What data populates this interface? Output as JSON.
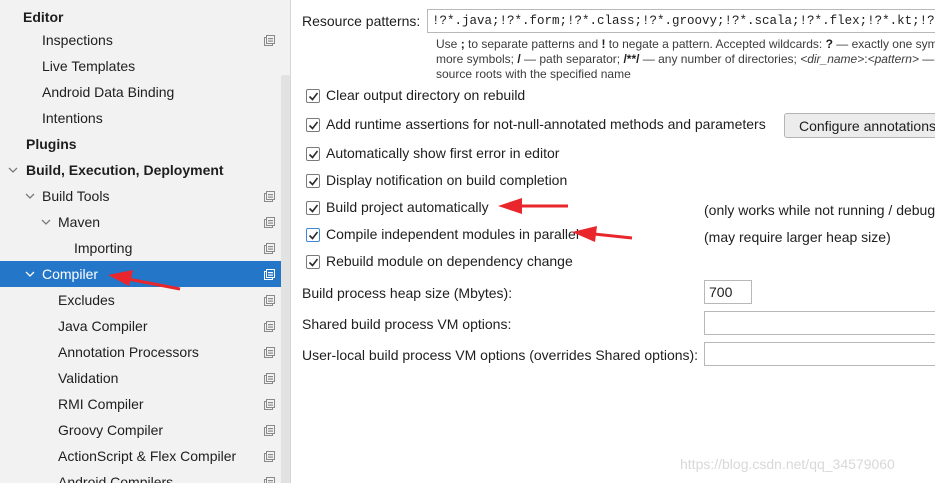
{
  "sidebar": {
    "items": [
      {
        "label": "Editor",
        "bold": true,
        "has_config_icon": false
      },
      {
        "label": "Inspections",
        "bold": false,
        "has_config_icon": true
      },
      {
        "label": "Live Templates",
        "bold": false,
        "has_config_icon": false
      },
      {
        "label": "Android Data Binding",
        "bold": false,
        "has_config_icon": false
      },
      {
        "label": "Intentions",
        "bold": false,
        "has_config_icon": false
      },
      {
        "label": "Plugins",
        "bold": true,
        "has_config_icon": false
      },
      {
        "label": "Build, Execution, Deployment",
        "bold": true,
        "expanded": true,
        "has_config_icon": false
      },
      {
        "label": "Build Tools",
        "bold": false,
        "expanded": true,
        "has_config_icon": true
      },
      {
        "label": "Maven",
        "bold": false,
        "expanded": true,
        "has_config_icon": true
      },
      {
        "label": "Importing",
        "bold": false,
        "has_config_icon": true
      },
      {
        "label": "Compiler",
        "bold": false,
        "expanded": true,
        "selected": true,
        "has_config_icon": true
      },
      {
        "label": "Excludes",
        "bold": false,
        "has_config_icon": true
      },
      {
        "label": "Java Compiler",
        "bold": false,
        "has_config_icon": true
      },
      {
        "label": "Annotation Processors",
        "bold": false,
        "has_config_icon": true
      },
      {
        "label": "Validation",
        "bold": false,
        "has_config_icon": true
      },
      {
        "label": "RMI Compiler",
        "bold": false,
        "has_config_icon": true
      },
      {
        "label": "Groovy Compiler",
        "bold": false,
        "has_config_icon": true
      },
      {
        "label": "ActionScript & Flex Compiler",
        "bold": false,
        "has_config_icon": true
      },
      {
        "label": "Android Compilers",
        "bold": false,
        "has_config_icon": true
      }
    ]
  },
  "compiler": {
    "resource_patterns_label": "Resource patterns:",
    "resource_patterns_value": "!?*.java;!?*.form;!?*.class;!?*.groovy;!?*.scala;!?*.flex;!?*.kt;!?*.clj",
    "hint": {
      "line1_a": "Use ",
      "line1_b": ";",
      "line1_c": " to separate patterns and ",
      "line1_d": "!",
      "line1_e": " to negate a pattern. Accepted wildcards: ",
      "line1_f": "?",
      "line1_g": " — exactly one symbo",
      "line2_a": "more symbols; ",
      "line2_b": "/",
      "line2_c": " — path separator; ",
      "line2_d": "/**/",
      "line2_e": " — any number of directories; ",
      "line2_f": "<dir_name>",
      "line2_g": ":",
      "line2_h": "<pattern>",
      "line2_i": " — m",
      "line3": "source roots with the specified name"
    },
    "checkboxes": [
      {
        "label": "Clear output directory on rebuild",
        "checked": true
      },
      {
        "label": "Add runtime assertions for not-null-annotated methods and parameters",
        "checked": true
      },
      {
        "label": "Automatically show first error in editor",
        "checked": true
      },
      {
        "label": "Display notification on build completion",
        "checked": true
      },
      {
        "label": "Build project automatically",
        "checked": true
      },
      {
        "label": "Compile independent modules in parallel",
        "checked": true
      },
      {
        "label": "Rebuild module on dependency change",
        "checked": true
      }
    ],
    "configure_annotations_button": "Configure annotations...",
    "build_auto_note": "(only works while not running / debugging)",
    "parallel_note": "(may require larger heap size)",
    "heap_size_label": "Build process heap size (Mbytes):",
    "heap_size_value": "700",
    "shared_vm_label": "Shared build process VM options:",
    "shared_vm_value": "",
    "user_vm_label": "User-local build process VM options (overrides Shared options):",
    "user_vm_value": ""
  },
  "watermark": "https://blog.csdn.net/qq_34579060",
  "colors": {
    "selection": "#2476c9",
    "arrow": "#e8262b",
    "sidebar_bg": "#f2f2f2"
  }
}
